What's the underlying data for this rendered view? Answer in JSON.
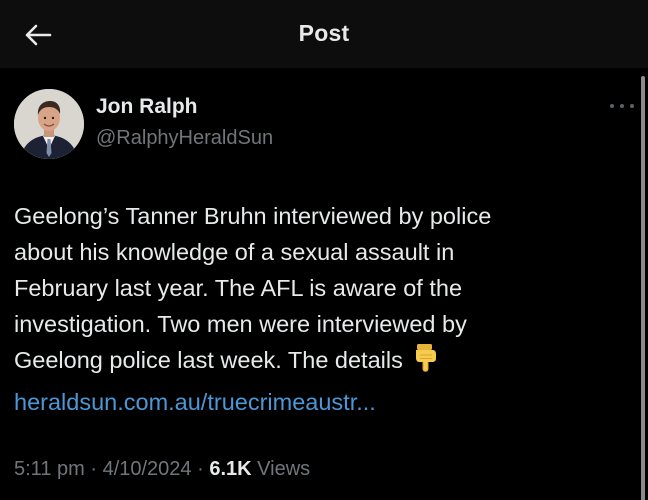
{
  "header": {
    "title": "Post",
    "back_icon": "arrow-left-icon"
  },
  "author": {
    "name": "Jon Ralph",
    "handle": "@RalphyHeraldSun",
    "avatar_icon": "profile-photo"
  },
  "post": {
    "lines": [
      "Geelong’s Tanner Bruhn interviewed by police",
      "about his knowledge of a sexual assault in",
      "February last year. The AFL is aware of the",
      "investigation. Two men were interviewed by",
      "Geelong police last week. The details"
    ],
    "emoji": "pointing-down-hand-icon",
    "link_text": "heraldsun.com.au/truecrimeaustr..."
  },
  "meta": {
    "time": "5:11 pm",
    "separator": "·",
    "date": "4/10/2024",
    "views_count": "6.1K",
    "views_label": "Views"
  },
  "colors": {
    "background": "#000000",
    "header_bg": "#0d0d0d",
    "text_primary": "#e7e9ea",
    "text_secondary": "#71767b",
    "link": "#4c97d6"
  }
}
